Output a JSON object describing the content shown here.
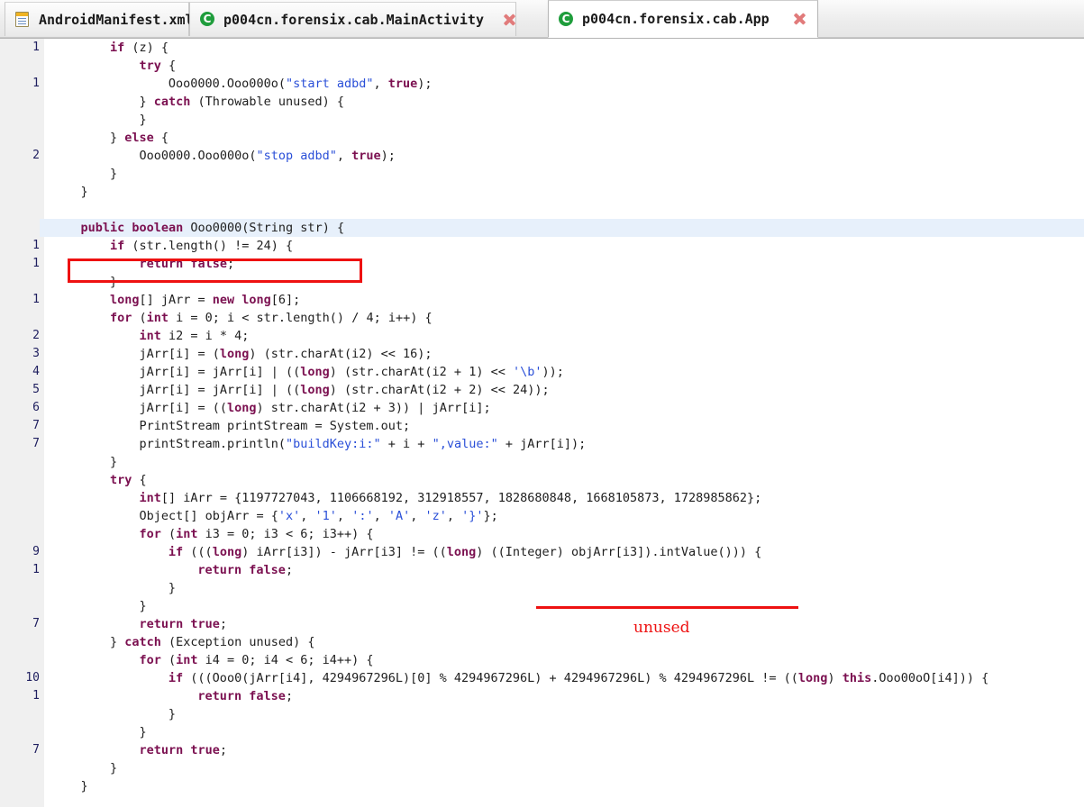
{
  "window": {
    "title": "Java decompiler editor"
  },
  "tabbar": {
    "tabs": [
      {
        "label": "AndroidManifest.xml",
        "icon": "xml-document-icon",
        "active": false,
        "close_icon": "close-icon"
      },
      {
        "label": "p004cn.forensix.cab.MainActivity",
        "icon": "java-class-icon",
        "active": false,
        "close_icon": "close-icon"
      },
      {
        "label": "p004cn.forensix.cab.App",
        "icon": "java-class-icon",
        "active": true,
        "close_icon": "close-icon"
      }
    ]
  },
  "colors": {
    "keyword": "#7b1050",
    "string": "#2a4fd8",
    "annotation_red": "#ee1111",
    "line_highlight": "#e7f0fb",
    "gutter_bg": "#f0f0f0",
    "linenum": "#202060"
  },
  "annotations": [
    {
      "type": "box",
      "name": "method-signature-highlight-box",
      "color": "#ee1111"
    },
    {
      "type": "underline",
      "name": "integer-cast-underline",
      "color": "#ee1111"
    },
    {
      "type": "label",
      "name": "unused-annotation-label",
      "text": "unused",
      "color": "#ee1111"
    }
  ],
  "editor": {
    "rows": [
      {
        "num": "1",
        "indent": 8,
        "html": "<span class=\"k\">if</span> (z) {"
      },
      {
        "num": "",
        "indent": 12,
        "html": "<span class=\"k\">try</span> {"
      },
      {
        "num": "1",
        "indent": 16,
        "html": "Ooo0000.Ooo000o(<span class=\"s\">\"start adbd\"</span>, <span class=\"k\">true</span>);"
      },
      {
        "num": "",
        "indent": 12,
        "html": "} <span class=\"k\">catch</span> (Throwable unused) {"
      },
      {
        "num": "",
        "indent": 12,
        "html": "}"
      },
      {
        "num": "",
        "indent": 8,
        "html": "} <span class=\"k\">else</span> {"
      },
      {
        "num": "2",
        "indent": 12,
        "html": "Ooo0000.Ooo000o(<span class=\"s\">\"stop adbd\"</span>, <span class=\"k\">true</span>);"
      },
      {
        "num": "",
        "indent": 8,
        "html": "}"
      },
      {
        "num": "",
        "indent": 4,
        "html": "}"
      },
      {
        "num": "",
        "indent": 0,
        "html": ""
      },
      {
        "num": "",
        "indent": 4,
        "html": "<span class=\"k\">public boolean</span> Ooo0000(String str) {",
        "highlight": true
      },
      {
        "num": "1",
        "indent": 8,
        "html": "<span class=\"k\">if</span> (str.length() != 24) {"
      },
      {
        "num": "1",
        "indent": 12,
        "html": "<span class=\"k\">return false</span>;"
      },
      {
        "num": "",
        "indent": 8,
        "html": "}"
      },
      {
        "num": "1",
        "indent": 8,
        "html": "<span class=\"k\">long</span>[] jArr = <span class=\"k\">new long</span>[6];"
      },
      {
        "num": "",
        "indent": 8,
        "html": "<span class=\"k\">for</span> (<span class=\"k\">int</span> i = 0; i &lt; str.length() / 4; i++) {"
      },
      {
        "num": "2",
        "indent": 12,
        "html": "<span class=\"k\">int</span> i2 = i * 4;"
      },
      {
        "num": "3",
        "indent": 12,
        "html": "jArr[i] = (<span class=\"k\">long</span>) (str.charAt(i2) &lt;&lt; 16);"
      },
      {
        "num": "4",
        "indent": 12,
        "html": "jArr[i] = jArr[i] | ((<span class=\"k\">long</span>) (str.charAt(i2 + 1) &lt;&lt; <span class=\"ch\">'\\b'</span>));"
      },
      {
        "num": "5",
        "indent": 12,
        "html": "jArr[i] = jArr[i] | ((<span class=\"k\">long</span>) (str.charAt(i2 + 2) &lt;&lt; 24));"
      },
      {
        "num": "6",
        "indent": 12,
        "html": "jArr[i] = ((<span class=\"k\">long</span>) str.charAt(i2 + 3)) | jArr[i];"
      },
      {
        "num": "7",
        "indent": 12,
        "html": "PrintStream printStream = System.out;"
      },
      {
        "num": "7",
        "indent": 12,
        "html": "printStream.println(<span class=\"s\">\"buildKey:i:\"</span> + i + <span class=\"s\">\",value:\"</span> + jArr[i]);"
      },
      {
        "num": "",
        "indent": 8,
        "html": "}"
      },
      {
        "num": "",
        "indent": 8,
        "html": "<span class=\"k\">try</span> {"
      },
      {
        "num": "",
        "indent": 12,
        "html": "<span class=\"k\">int</span>[] iArr = {1197727043, 1106668192, 312918557, 1828680848, 1668105873, 1728985862};"
      },
      {
        "num": "",
        "indent": 12,
        "html": "Object[] objArr = {<span class=\"ch\">'x'</span>, <span class=\"ch\">'1'</span>, <span class=\"ch\">':'</span>, <span class=\"ch\">'A'</span>, <span class=\"ch\">'z'</span>, <span class=\"ch\">'}'</span>};"
      },
      {
        "num": "",
        "indent": 12,
        "html": "<span class=\"k\">for</span> (<span class=\"k\">int</span> i3 = 0; i3 &lt; 6; i3++) {"
      },
      {
        "num": "9",
        "indent": 16,
        "html": "<span class=\"k\">if</span> (((<span class=\"k\">long</span>) iArr[i3]) - jArr[i3] != ((<span class=\"k\">long</span>) ((Integer) objArr[i3]).intValue())) {"
      },
      {
        "num": "1",
        "indent": 20,
        "html": "<span class=\"k\">return false</span>;"
      },
      {
        "num": "",
        "indent": 16,
        "html": "}"
      },
      {
        "num": "",
        "indent": 12,
        "html": "}"
      },
      {
        "num": "7",
        "indent": 12,
        "html": "<span class=\"k\">return true</span>;"
      },
      {
        "num": "",
        "indent": 8,
        "html": "} <span class=\"k\">catch</span> (Exception unused) {"
      },
      {
        "num": "",
        "indent": 12,
        "html": "<span class=\"k\">for</span> (<span class=\"k\">int</span> i4 = 0; i4 &lt; 6; i4++) {"
      },
      {
        "num": "10",
        "indent": 16,
        "html": "<span class=\"k\">if</span> (((Ooo0(jArr[i4], 4294967296L)[0] % 4294967296L) + 4294967296L) % 4294967296L != ((<span class=\"k\">long</span>) <span class=\"k\">this</span>.Ooo00oO[i4])) {"
      },
      {
        "num": "1",
        "indent": 20,
        "html": "<span class=\"k\">return false</span>;"
      },
      {
        "num": "",
        "indent": 16,
        "html": "}"
      },
      {
        "num": "",
        "indent": 12,
        "html": "}"
      },
      {
        "num": "7",
        "indent": 12,
        "html": "<span class=\"k\">return true</span>;"
      },
      {
        "num": "",
        "indent": 8,
        "html": "}"
      },
      {
        "num": "",
        "indent": 4,
        "html": "}"
      }
    ],
    "plain_text_lines": [
      "        if (z) {",
      "            try {",
      "                Ooo0000.Ooo000o(\"start adbd\", true);",
      "            } catch (Throwable unused) {",
      "            }",
      "        } else {",
      "            Ooo0000.Ooo000o(\"stop adbd\", true);",
      "        }",
      "    }",
      "",
      "    public boolean Ooo0000(String str) {",
      "        if (str.length() != 24) {",
      "            return false;",
      "        }",
      "        long[] jArr = new long[6];",
      "        for (int i = 0; i < str.length() / 4; i++) {",
      "            int i2 = i * 4;",
      "            jArr[i] = (long) (str.charAt(i2) << 16);",
      "            jArr[i] = jArr[i] | ((long) (str.charAt(i2 + 1) << '\\b'));",
      "            jArr[i] = jArr[i] | ((long) (str.charAt(i2 + 2) << 24));",
      "            jArr[i] = ((long) str.charAt(i2 + 3)) | jArr[i];",
      "            PrintStream printStream = System.out;",
      "            printStream.println(\"buildKey:i:\" + i + \",value:\" + jArr[i]);",
      "        }",
      "        try {",
      "            int[] iArr = {1197727043, 1106668192, 312918557, 1828680848, 1668105873, 1728985862};",
      "            Object[] objArr = {'x', '1', ':', 'A', 'z', '}'};",
      "            for (int i3 = 0; i3 < 6; i3++) {",
      "                if (((long) iArr[i3]) - jArr[i3] != ((long) ((Integer) objArr[i3]).intValue())) {",
      "                    return false;",
      "                }",
      "            }",
      "            return true;",
      "        } catch (Exception unused) {",
      "            for (int i4 = 0; i4 < 6; i4++) {",
      "                if (((Ooo0(jArr[i4], 4294967296L)[0] % 4294967296L) + 4294967296L) % 4294967296L != ((long) this.Ooo00oO[i4])) {",
      "                    return false;",
      "                }",
      "            }",
      "            return true;",
      "        }",
      "    }"
    ]
  }
}
